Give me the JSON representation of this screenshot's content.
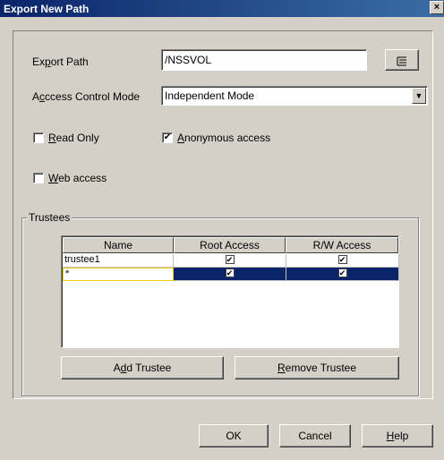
{
  "window": {
    "title": "Export New Path",
    "close_glyph": "×"
  },
  "form": {
    "export_path": {
      "label_pre": "Ex",
      "label_acc": "p",
      "label_post": "ort Path",
      "value": "/NSSVOL",
      "browse_icon": "tree-browse-icon"
    },
    "access_mode": {
      "label_pre": "A",
      "label_acc": "c",
      "label_post": "ccess Control Mode",
      "value": "Independent Mode",
      "arrow_glyph": "▼"
    },
    "read_only": {
      "label_pre": "",
      "label_acc": "R",
      "label_post": "ead Only",
      "checked": false
    },
    "anonymous": {
      "label_pre": "",
      "label_acc": "A",
      "label_post": "nonymous access",
      "checked": true
    },
    "web_access": {
      "label_pre": "",
      "label_acc": "W",
      "label_post": "eb access",
      "checked": false
    }
  },
  "trustees": {
    "group_title": "Trustees",
    "columns": [
      "Name",
      "Root Access",
      "R/W Access"
    ],
    "rows": [
      {
        "name": "trustee1",
        "root": true,
        "rw": true,
        "selected": false
      },
      {
        "name": "*",
        "root": true,
        "rw": true,
        "selected": true
      }
    ],
    "check_glyph": "✔",
    "add_button": {
      "pre": "A",
      "acc": "d",
      "post": "d Trustee"
    },
    "remove_button": {
      "pre": "",
      "acc": "R",
      "post": "emove Trustee"
    }
  },
  "footer": {
    "ok": "OK",
    "cancel": "Cancel",
    "help_pre": "",
    "help_acc": "H",
    "help_post": "elp"
  }
}
